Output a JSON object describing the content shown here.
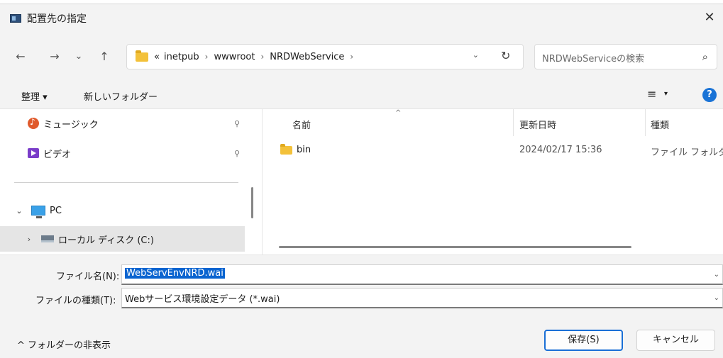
{
  "window": {
    "title": "配置先の指定",
    "close_glyph": "✕"
  },
  "nav": {
    "back_glyph": "←",
    "forward_glyph": "→",
    "recent_glyph": "⌄",
    "up_glyph": "↑",
    "breadcrumb": {
      "overflow": "«",
      "items": [
        "inetpub",
        "wwwroot",
        "NRDWebService"
      ],
      "separator": "›",
      "dropdown_glyph": "⌄",
      "refresh_glyph": "↻"
    },
    "search": {
      "placeholder": "NRDWebServiceの検索",
      "icon_glyph": "⌕"
    }
  },
  "commandbar": {
    "organize_label": "整理 ▾",
    "new_folder_label": "新しいフォルダー",
    "view_glyph": "≡",
    "view_caret": "▾",
    "help_glyph": "?"
  },
  "navpane": {
    "music_label": "ミュージック",
    "video_label": "ビデオ",
    "pin_glyph": "📌",
    "pc_label": "PC",
    "pc_chevron": "⌄",
    "disk_label": "ローカル ディスク (C:)",
    "disk_chevron": "›"
  },
  "filelist": {
    "columns": [
      "名前",
      "更新日時",
      "種類"
    ],
    "sort_glyph": "^",
    "rows": [
      {
        "name": "bin",
        "date": "2024/02/17 15:36",
        "type": "ファイル フォルダー"
      }
    ]
  },
  "form": {
    "filename_label": "ファイル名(N):",
    "filename_value": "WebServEnvNRD.wai",
    "filetype_label": "ファイルの種類(T):",
    "filetype_value": "Webサービス環境設定データ (*.wai)",
    "dropdown_glyph": "⌄"
  },
  "footer": {
    "hide_folders_label": "^ フォルダーの非表示",
    "save_label": "保存(S)",
    "cancel_label": "キャンセル"
  },
  "colors": {
    "accent": "#1a6fd6",
    "selection": "#0a64d0",
    "folder": "#f3c13a"
  }
}
